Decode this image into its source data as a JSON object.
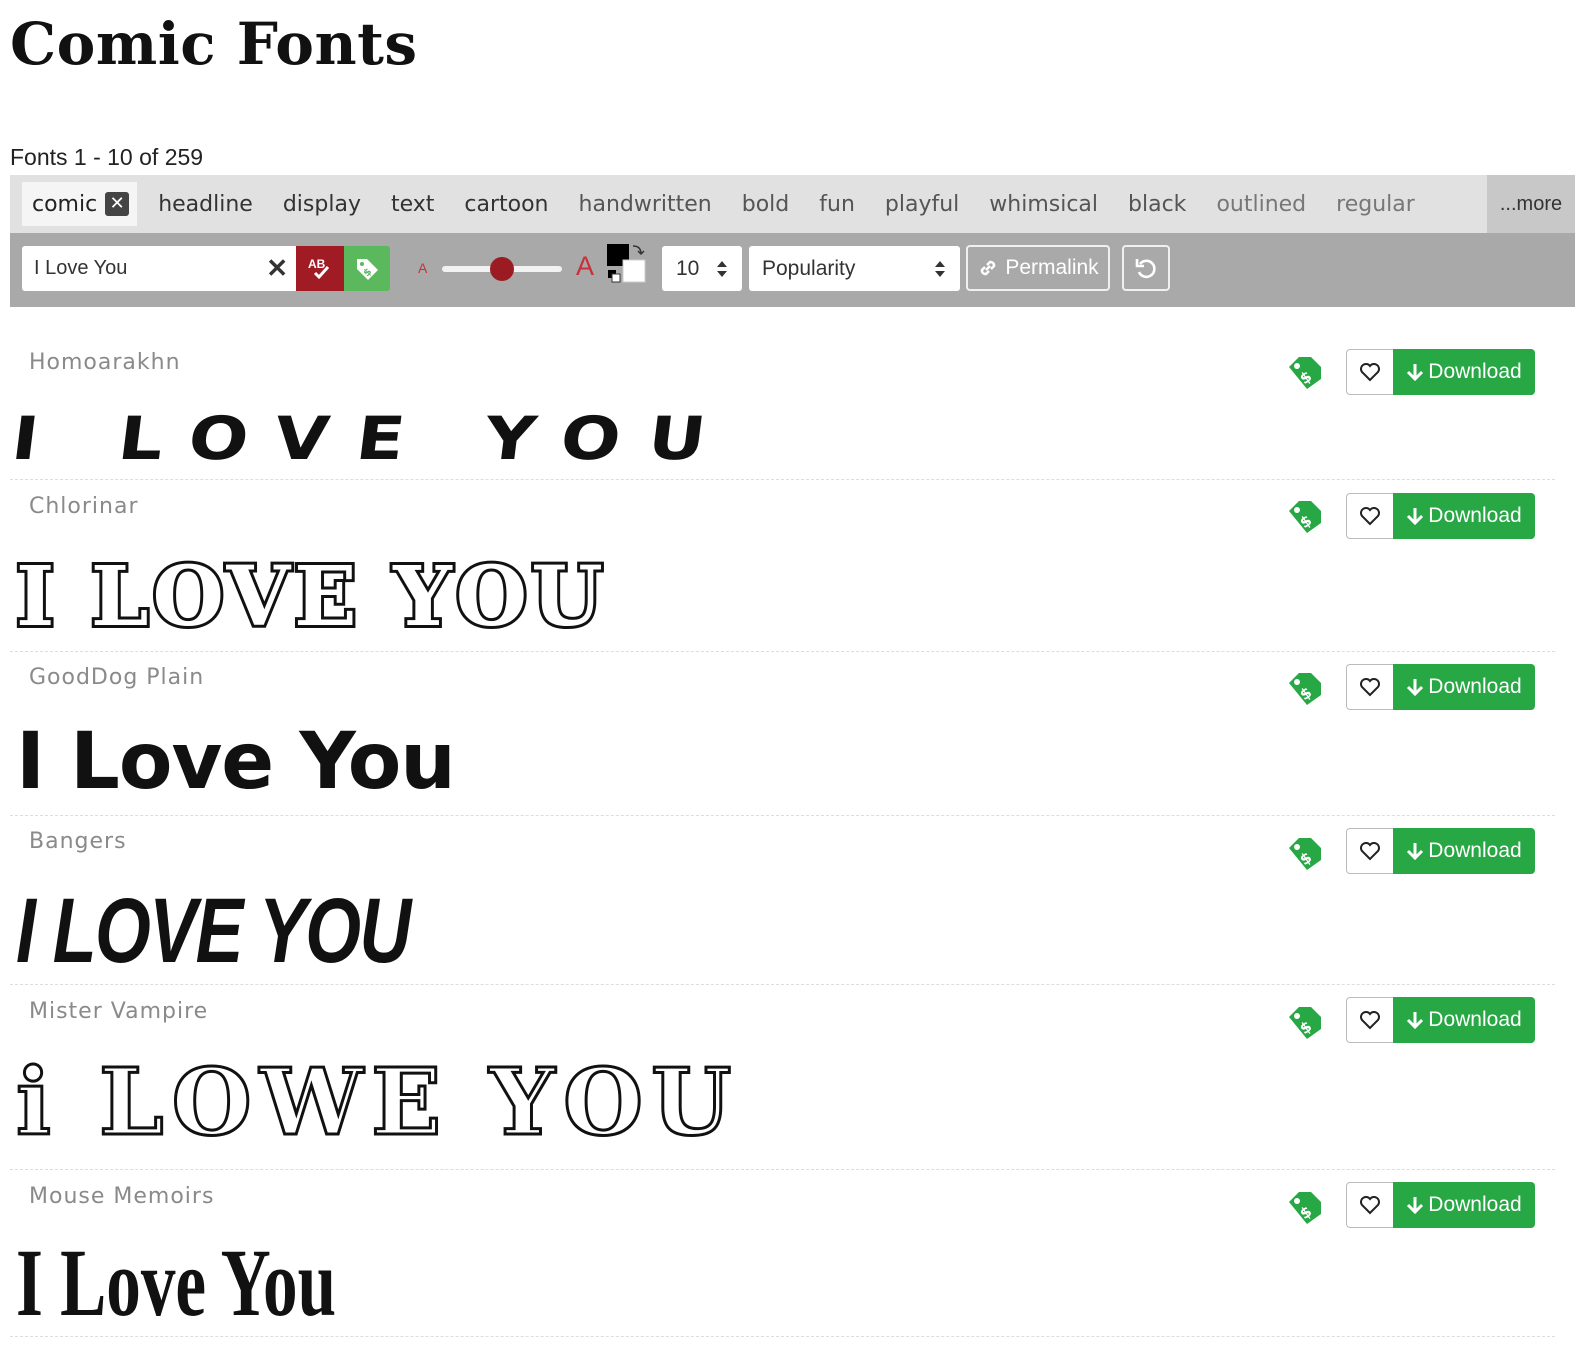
{
  "page": {
    "title": "Comic Fonts",
    "results": "Fonts 1 - 10 of 259"
  },
  "tags": {
    "active": "comic",
    "items": [
      {
        "label": "headline",
        "weight": "strong"
      },
      {
        "label": "display",
        "weight": "strong"
      },
      {
        "label": "text",
        "weight": "strong"
      },
      {
        "label": "cartoon",
        "weight": "strong"
      },
      {
        "label": "handwritten",
        "weight": "mid"
      },
      {
        "label": "bold",
        "weight": "mid"
      },
      {
        "label": "fun",
        "weight": "mid"
      },
      {
        "label": "playful",
        "weight": "mid"
      },
      {
        "label": "whimsical",
        "weight": "mid"
      },
      {
        "label": "black",
        "weight": "mid"
      },
      {
        "label": "outlined",
        "weight": "light"
      },
      {
        "label": "regular",
        "weight": "light"
      }
    ],
    "more": "...more"
  },
  "controls": {
    "preview_text": "I Love You",
    "count": "10",
    "sort": "Popularity",
    "permalink": "Permalink",
    "size_small": "A",
    "size_large": "A",
    "size_value": 0.5
  },
  "fonts": [
    {
      "name": "Homoarakhn",
      "sample": "I LOVE YOU",
      "download": "Download"
    },
    {
      "name": "Chlorinar",
      "sample": "I LOVE YOU",
      "download": "Download"
    },
    {
      "name": "GoodDog Plain",
      "sample": "I Love You",
      "download": "Download"
    },
    {
      "name": "Bangers",
      "sample": "I LOVE YOU",
      "download": "Download"
    },
    {
      "name": "Mister Vampire",
      "sample": "i LOWE YOU",
      "download": "Download"
    },
    {
      "name": "Mouse Memoirs",
      "sample": "I Love You",
      "download": "Download"
    }
  ],
  "colors": {
    "tag_bar": "#e1e1e1",
    "controls_bar": "#a9a9a9",
    "case_button": "#a01b23",
    "free_button": "#5cb85c",
    "download": "#28a745",
    "tag_icon": "#28a745",
    "slider_thumb": "#9b1b22"
  },
  "icons": {
    "tag_clear": "close-icon",
    "input_clear": "close-icon",
    "case": "text-case-icon",
    "free": "price-tag-icon",
    "swap_colors": "swap-colors-icon",
    "permalink": "link-icon",
    "reset": "undo-icon",
    "favorite": "heart-icon",
    "download": "arrow-down-icon",
    "license": "price-tag-icon"
  }
}
